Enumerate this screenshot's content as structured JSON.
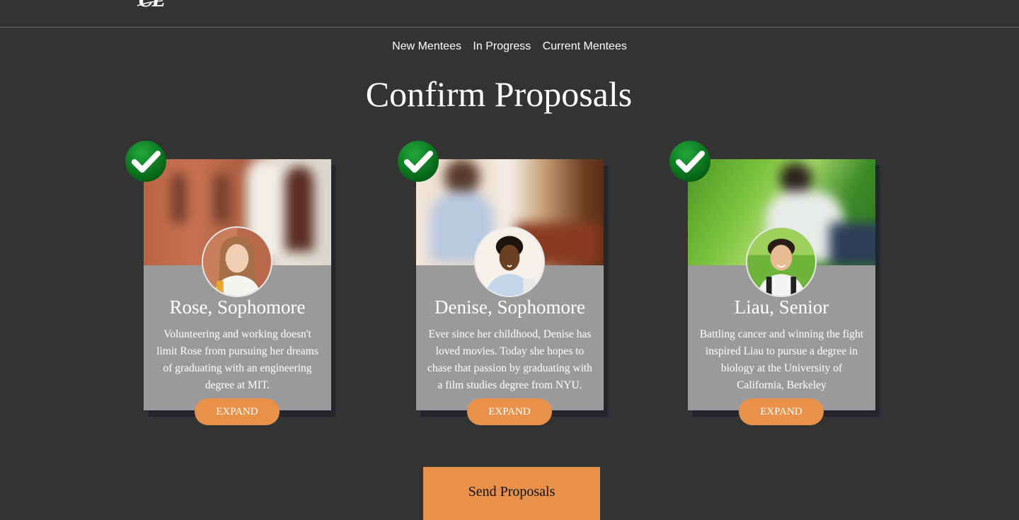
{
  "logo": {
    "text": "CL"
  },
  "nav": [
    "New Mentees",
    "In Progress",
    "Current Mentees"
  ],
  "page_title": "Confirm Proposals",
  "cards": [
    {
      "name": "Rose, Sophomore",
      "description": "Volunteering and working doesn't limit Rose from pursuing her dreams of graduating with an engineering degree at MIT.",
      "button": "EXPAND",
      "checked": true
    },
    {
      "name": "Denise, Sophomore",
      "description": "Ever since her childhood, Denise has loved movies. Today she hopes to chase that passion by graduating with a film studies degree from NYU.",
      "button": "EXPAND",
      "checked": true
    },
    {
      "name": "Liau, Senior",
      "description": "Battling cancer and winning the fight inspired Liau to pursue a degree in biology at the University of California, Berkeley",
      "button": "EXPAND",
      "checked": true
    }
  ],
  "send_button": "Send Proposals",
  "colors": {
    "background": "#333333",
    "card": "#9a9a9a",
    "accent": "#e8914a",
    "check": "#0a7a1e"
  }
}
